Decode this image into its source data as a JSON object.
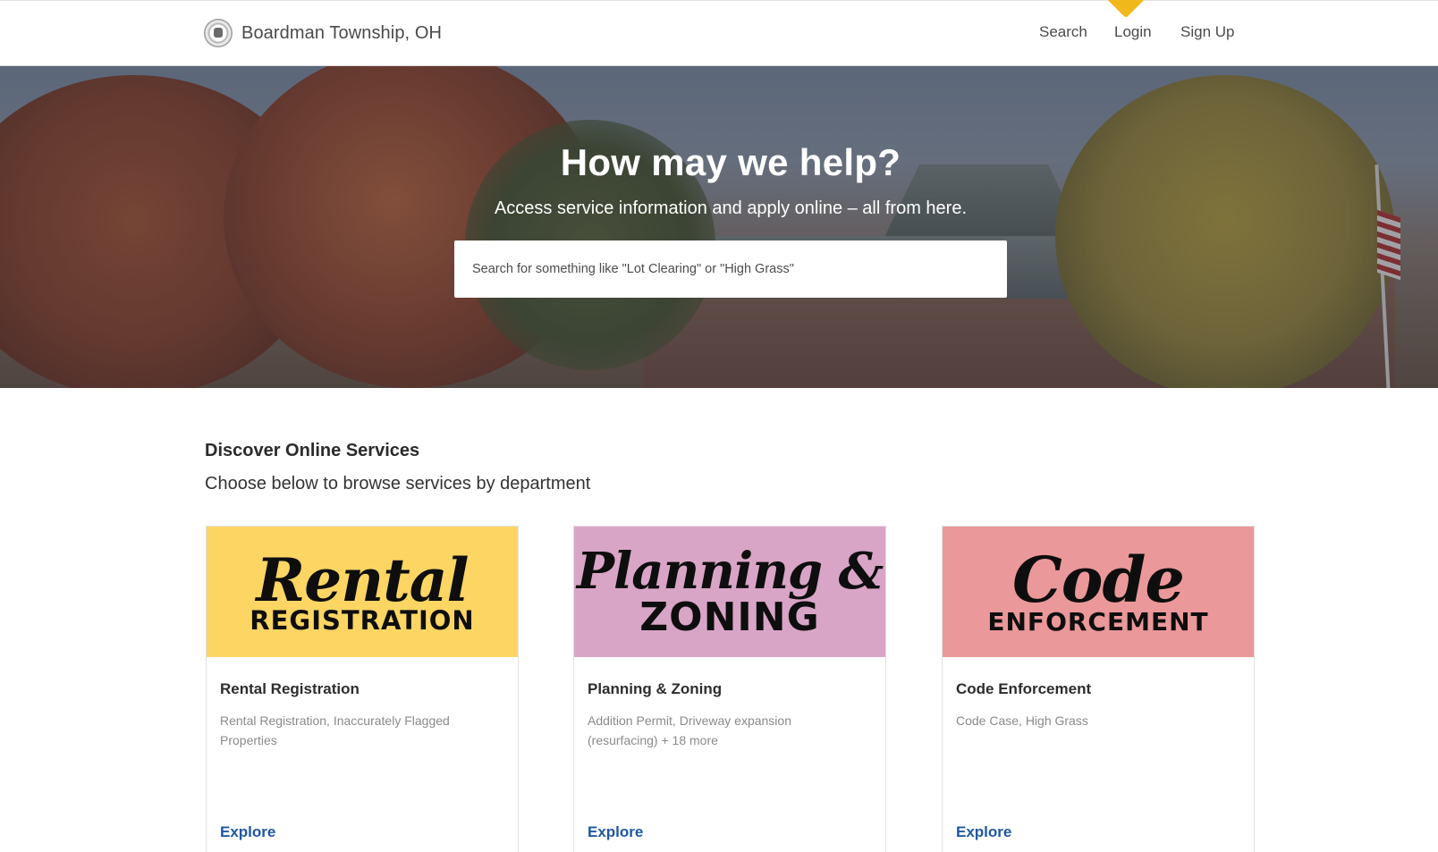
{
  "header": {
    "brand_name": "Boardman Township, OH",
    "nav": [
      "Search",
      "Login",
      "Sign Up"
    ]
  },
  "hero": {
    "title": "How may we help?",
    "subtitle": "Access service information and apply online – all from here.",
    "search_placeholder": "Search for something like \"Lot Clearing\" or \"High Grass\""
  },
  "services": {
    "title": "Discover Online Services",
    "subtitle": "Choose below to browse services by department",
    "cards": [
      {
        "banner_script": "Rental",
        "banner_caps": "REGISTRATION",
        "banner_color": "#fcd563",
        "title": "Rental Registration",
        "description": "Rental Registration, Inaccurately Flagged Properties",
        "link": "Explore"
      },
      {
        "banner_script": "Planning &",
        "banner_caps": "ZONING",
        "banner_color": "#d9a5c6",
        "title": "Planning & Zoning",
        "description": "Addition Permit, Driveway expansion (resurfacing) + 18 more",
        "link": "Explore"
      },
      {
        "banner_script": "Code",
        "banner_caps": "ENFORCEMENT",
        "banner_color": "#eb989a",
        "title": "Code Enforcement",
        "description": "Code Case, High Grass",
        "link": "Explore"
      }
    ]
  },
  "colors": {
    "link": "#1f57a3",
    "pointer": "#f1b81c"
  }
}
